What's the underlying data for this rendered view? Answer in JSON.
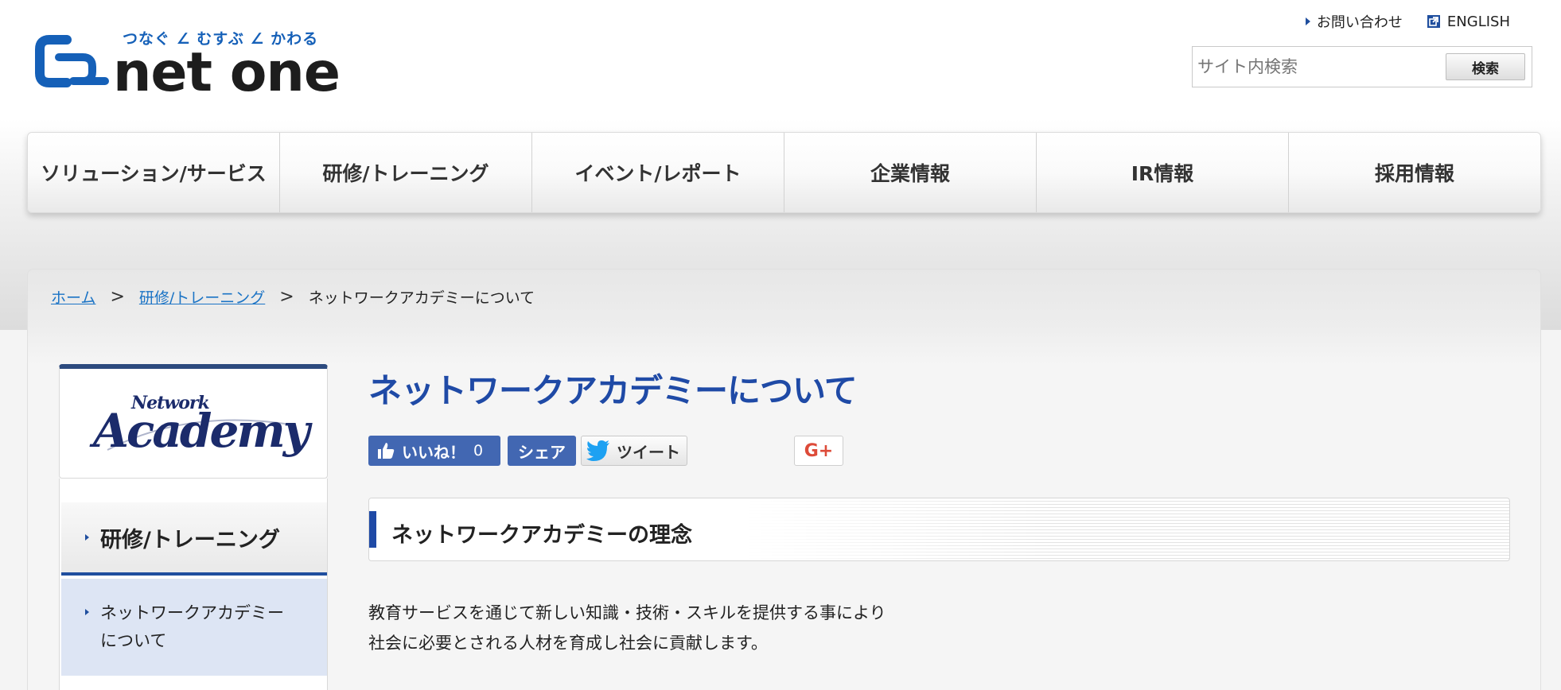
{
  "header": {
    "tagline": "つなぐ ∠ むすぶ ∠ かわる",
    "logo_text": "net one",
    "util_links": [
      {
        "label": "お問い合わせ",
        "icon": "triangle-right-icon"
      },
      {
        "label": "ENGLISH",
        "icon": "external-link-icon"
      }
    ],
    "search": {
      "placeholder": "サイト内検索",
      "button_label": "検索"
    }
  },
  "nav": {
    "items": [
      "ソリューション/サービス",
      "研修/トレーニング",
      "イベント/レポート",
      "企業情報",
      "IR情報",
      "採用情報"
    ]
  },
  "breadcrumb": {
    "home": "ホーム",
    "section": "研修/トレーニング",
    "current": "ネットワークアカデミーについて",
    "separator": ">"
  },
  "sidebar": {
    "logo_small": "Network",
    "logo_big": "Academy",
    "menu_head": "研修/トレーニング",
    "menu_sub": "ネットワークアカデミーについて"
  },
  "main": {
    "title": "ネットワークアカデミーについて",
    "social": {
      "like_label": "いいね！",
      "like_count": "0",
      "share_label": "シェア",
      "tweet_label": "ツイート",
      "gplus_label": "G+"
    },
    "section_heading": "ネットワークアカデミーの理念",
    "body_lines": [
      "教育サービスを通じて新しい知識・技術・スキルを提供する事により",
      "社会に必要とされる人材を育成し社会に貢献します。"
    ]
  },
  "colors": {
    "brand_blue": "#1f4aa6",
    "link_blue": "#1a73c5",
    "facebook_blue": "#4267b2",
    "sidebar_highlight": "#dde5f4"
  }
}
